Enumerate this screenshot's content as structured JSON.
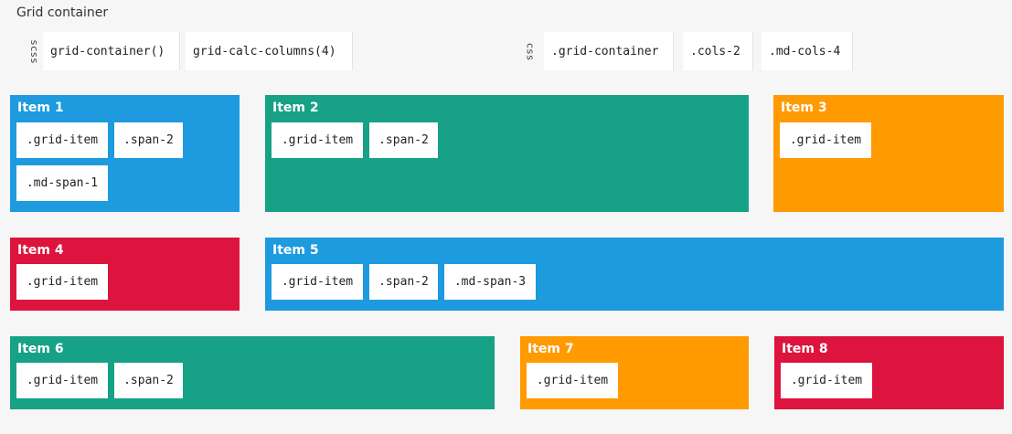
{
  "header": {
    "title": "Grid container"
  },
  "scss": {
    "lang": "scss",
    "snippets": [
      "grid-container()",
      "grid-calc-columns(4)"
    ]
  },
  "css": {
    "lang": "css",
    "snippets": [
      ".grid-container",
      ".cols-2",
      ".md-cols-4"
    ]
  },
  "colors": {
    "blue": "#1e9ade",
    "teal": "#17a187",
    "orange": "#ff9a00",
    "red": "#dd143d"
  },
  "items": [
    {
      "label": "Item 1",
      "color": "blue",
      "classes": [
        ".grid-item",
        ".span-2",
        ".md-span-1"
      ]
    },
    {
      "label": "Item 2",
      "color": "teal",
      "classes": [
        ".grid-item",
        ".span-2"
      ]
    },
    {
      "label": "Item 3",
      "color": "orange",
      "classes": [
        ".grid-item"
      ]
    },
    {
      "label": "Item 4",
      "color": "red",
      "classes": [
        ".grid-item"
      ]
    },
    {
      "label": "Item 5",
      "color": "blue",
      "classes": [
        ".grid-item",
        ".span-2",
        ".md-span-3"
      ]
    },
    {
      "label": "Item 6",
      "color": "teal",
      "classes": [
        ".grid-item",
        ".span-2"
      ]
    },
    {
      "label": "Item 7",
      "color": "orange",
      "classes": [
        ".grid-item"
      ]
    },
    {
      "label": "Item 8",
      "color": "red",
      "classes": [
        ".grid-item"
      ]
    }
  ]
}
